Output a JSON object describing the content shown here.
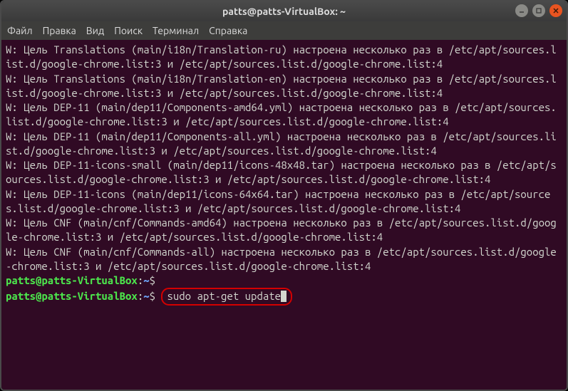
{
  "window": {
    "title": "patts@patts-VirtualBox: ~"
  },
  "menubar": {
    "file": "Файл",
    "edit": "Правка",
    "view": "Вид",
    "search": "Поиск",
    "terminal": "Терминал",
    "help": "Справка"
  },
  "terminal": {
    "lines": [
      "W: Цель Translations (main/i18n/Translation-ru) настроена несколько раз в /etc/apt/sources.list.d/google-chrome.list:3 и /etc/apt/sources.list.d/google-chrome.list:4",
      "W: Цель Translations (main/i18n/Translation-en) настроена несколько раз в /etc/apt/sources.list.d/google-chrome.list:3 и /etc/apt/sources.list.d/google-chrome.list:4",
      "W: Цель DEP-11 (main/dep11/Components-amd64.yml) настроена несколько раз в /etc/apt/sources.list.d/google-chrome.list:3 и /etc/apt/sources.list.d/google-chrome.list:4",
      "W: Цель DEP-11 (main/dep11/Components-all.yml) настроена несколько раз в /etc/apt/sources.list.d/google-chrome.list:3 и /etc/apt/sources.list.d/google-chrome.list:4",
      "W: Цель DEP-11-icons-small (main/dep11/icons-48x48.tar) настроена несколько раз в /etc/apt/sources.list.d/google-chrome.list:3 и /etc/apt/sources.list.d/google-chrome.list:4",
      "W: Цель DEP-11-icons (main/dep11/icons-64x64.tar) настроена несколько раз в /etc/apt/sources.list.d/google-chrome.list:3 и /etc/apt/sources.list.d/google-chrome.list:4",
      "W: Цель CNF (main/cnf/Commands-amd64) настроена несколько раз в /etc/apt/sources.list.d/google-chrome.list:3 и /etc/apt/sources.list.d/google-chrome.list:4",
      "W: Цель CNF (main/cnf/Commands-all) настроена несколько раз в /etc/apt/sources.list.d/google-chrome.list:3 и /etc/apt/sources.list.d/google-chrome.list:4"
    ],
    "prompt": {
      "user_host": "patts@patts-VirtualBox",
      "path": "~",
      "symbol": "$"
    },
    "command": "sudo apt-get update"
  }
}
